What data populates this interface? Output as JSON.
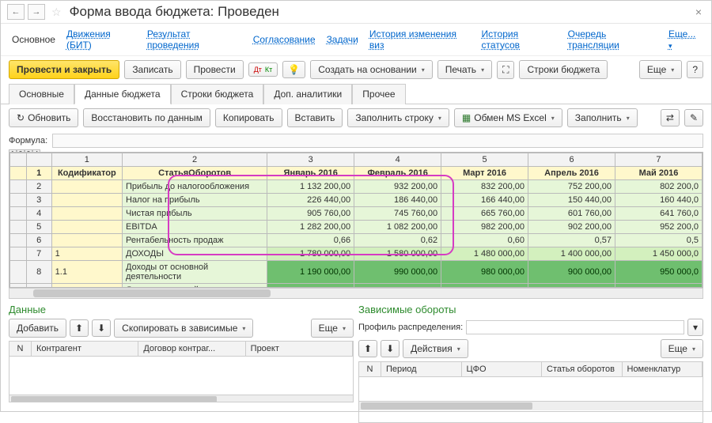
{
  "title": "Форма ввода бюджета: Проведен",
  "linkbar": {
    "main": "Основное",
    "items": [
      "Движения (БИТ)",
      "Результат проведения",
      "Согласование",
      "Задачи",
      "История изменения виз",
      "История статусов",
      "Очередь трансляции",
      "Еще..."
    ]
  },
  "toolbar1": {
    "post_close": "Провести и закрыть",
    "write": "Записать",
    "post": "Провести",
    "create_basis": "Создать на основании",
    "print": "Печать",
    "budget_rows": "Строки бюджета",
    "more": "Еще"
  },
  "tabs": {
    "items": [
      "Основные",
      "Данные бюджета",
      "Строки бюджета",
      "Доп. аналитики",
      "Прочее"
    ],
    "active": 1
  },
  "toolbar2": {
    "refresh": "Обновить",
    "restore": "Восстановить по данным",
    "copy": "Копировать",
    "paste": "Вставить",
    "fill_row": "Заполнить строку",
    "excel": "Обмен MS Excel",
    "fill": "Заполнить"
  },
  "formula_label": "Формула:",
  "grid": {
    "col_nums": [
      "1",
      "2",
      "3",
      "4",
      "5",
      "6",
      "7"
    ],
    "headers": [
      "Кодификатор",
      "СтатьяОборотов",
      "Январь 2016",
      "Февраль 2016",
      "Март 2016",
      "Апрель 2016",
      "Май 2016"
    ],
    "rows": [
      {
        "n": "2",
        "codif": "",
        "article": "Прибыль до налогообложения",
        "vals": [
          "1 132 200,00",
          "932 200,00",
          "832 200,00",
          "752 200,00",
          "802 200,0"
        ],
        "cls": "val"
      },
      {
        "n": "3",
        "codif": "",
        "article": "Налог на прибыль",
        "vals": [
          "226 440,00",
          "186 440,00",
          "166 440,00",
          "150 440,00",
          "160 440,0"
        ],
        "cls": "val"
      },
      {
        "n": "4",
        "codif": "",
        "article": "Чистая прибыль",
        "vals": [
          "905 760,00",
          "745 760,00",
          "665 760,00",
          "601 760,00",
          "641 760,0"
        ],
        "cls": "val"
      },
      {
        "n": "5",
        "codif": "",
        "article": "EBITDA",
        "vals": [
          "1 282 200,00",
          "1 082 200,00",
          "982 200,00",
          "902 200,00",
          "952 200,0"
        ],
        "cls": "val"
      },
      {
        "n": "6",
        "codif": "",
        "article": "Рентабельность продаж",
        "vals": [
          "0,66",
          "0,62",
          "0,60",
          "0,57",
          "0,5"
        ],
        "cls": "val"
      },
      {
        "n": "7",
        "codif": "1",
        "article": "ДОХОДЫ",
        "vals": [
          "1 780 000,00",
          "1 580 000,00",
          "1 480 000,00",
          "1 400 000,00",
          "1 450 000,0"
        ],
        "cls": "val-mid"
      },
      {
        "n": "8",
        "codif": "1.1",
        "article": "Доходы от основной деятельности",
        "vals": [
          "1 190 000,00",
          "990 000,00",
          "980 000,00",
          "900 000,00",
          "950 000,0"
        ],
        "cls": "val-dark"
      },
      {
        "n": "",
        "codif": "",
        "article": "Доходы от прочей",
        "vals": [
          "",
          "",
          "",
          "",
          ""
        ],
        "cls": "val-dark"
      }
    ]
  },
  "left_panel": {
    "title": "Данные",
    "add": "Добавить",
    "copy_dep": "Скопировать в зависимые",
    "more": "Еще",
    "cols": [
      "N",
      "Контрагент",
      "Договор контраг...",
      "Проект"
    ]
  },
  "right_panel": {
    "title": "Зависимые обороты",
    "profile_label": "Профиль распределения:",
    "actions": "Действия",
    "more": "Еще",
    "cols": [
      "N",
      "Период",
      "ЦФО",
      "Статья оборотов",
      "Номенклатур"
    ]
  }
}
